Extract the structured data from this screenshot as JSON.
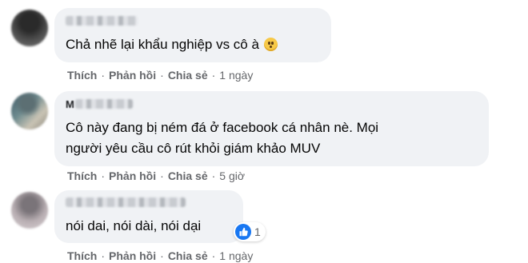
{
  "comments": [
    {
      "name_visible": "",
      "text_lines": [
        "Chả nhẽ lại khẩu nghiệp vs cô à"
      ],
      "emoji": "hushed-face-icon",
      "actions": {
        "like": "Thích",
        "reply": "Phản hồi",
        "share": "Chia sẻ",
        "time": "1 ngày"
      }
    },
    {
      "name_visible": "M",
      "text_lines": [
        "Cô này đang bị ném đá ở facebook cá nhân nè. Mọi",
        "người yêu cầu cô rút khỏi giám khảo MUV"
      ],
      "actions": {
        "like": "Thích",
        "reply": "Phản hồi",
        "share": "Chia sẻ",
        "time": "5 giờ"
      }
    },
    {
      "name_visible": "",
      "text_lines": [
        "nói dai, nói dài, nói dại"
      ],
      "reaction": {
        "icon": "like-icon",
        "count": "1",
        "color": "#1877f2"
      },
      "actions": {
        "like": "Thích",
        "reply": "Phản hồi",
        "share": "Chia sẻ",
        "time": "1 ngày"
      }
    }
  ],
  "colors": {
    "bubble": "#f0f2f5",
    "meta": "#65676b",
    "text": "#050505",
    "like_blue": "#1877f2"
  }
}
